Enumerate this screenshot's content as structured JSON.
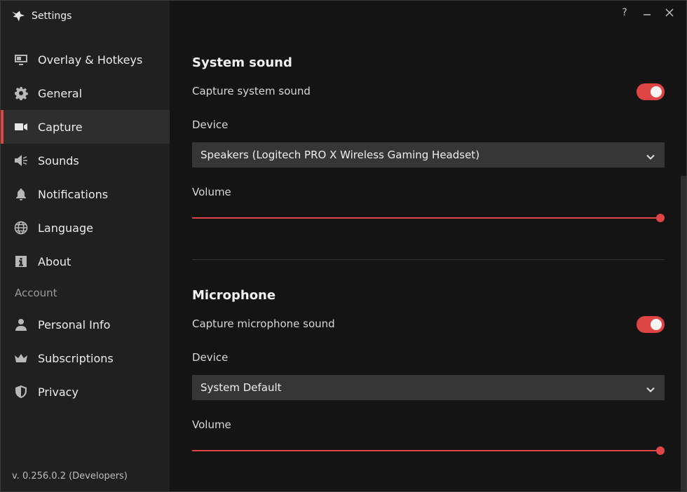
{
  "window": {
    "title": "Settings",
    "help_label": "?"
  },
  "sidebar": {
    "items": [
      {
        "label": "Overlay & Hotkeys",
        "icon": "monitor-icon"
      },
      {
        "label": "General",
        "icon": "gear-icon"
      },
      {
        "label": "Capture",
        "icon": "video-camera-icon",
        "active": true
      },
      {
        "label": "Sounds",
        "icon": "speaker-icon"
      },
      {
        "label": "Notifications",
        "icon": "bell-icon"
      },
      {
        "label": "Language",
        "icon": "globe-icon"
      },
      {
        "label": "About",
        "icon": "info-icon"
      }
    ],
    "account_section": "Account",
    "account_items": [
      {
        "label": "Personal Info",
        "icon": "person-icon"
      },
      {
        "label": "Subscriptions",
        "icon": "crown-icon"
      },
      {
        "label": "Privacy",
        "icon": "shield-icon"
      }
    ],
    "version": "v. 0.256.0.2 (Developers)"
  },
  "system_sound": {
    "title": "System sound",
    "capture_label": "Capture system sound",
    "capture_enabled": true,
    "device_label": "Device",
    "device_value": "Speakers (Logitech PRO X Wireless Gaming Headset)",
    "volume_label": "Volume",
    "volume": 1.0
  },
  "microphone": {
    "title": "Microphone",
    "capture_label": "Capture microphone sound",
    "capture_enabled": true,
    "device_label": "Device",
    "device_value": "System Default",
    "volume_label": "Volume",
    "volume": 1.0
  },
  "colors": {
    "accent": "#e04545",
    "sidebar_bg": "#202020",
    "content_bg": "#141414",
    "select_bg": "#363636"
  }
}
